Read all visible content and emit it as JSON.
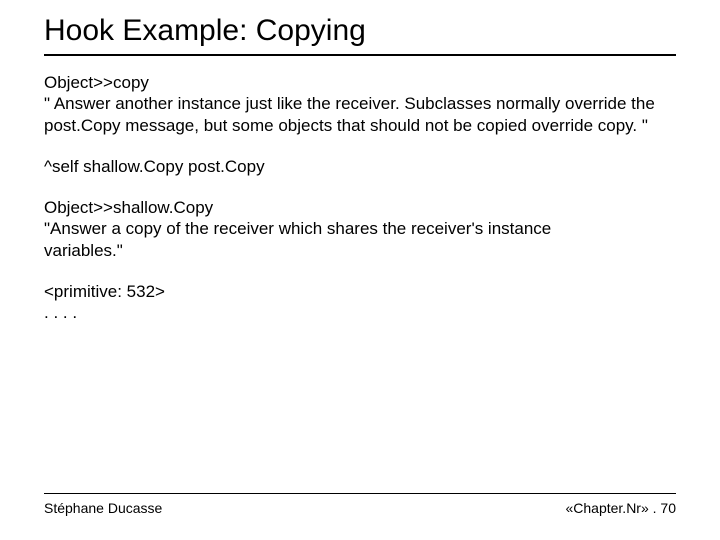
{
  "title": "Hook Example: Copying",
  "method1": {
    "sig": "Object>>copy",
    "comment": "\" Answer another instance just like the receiver. Subclasses normally override the post.Copy message, but some objects that should not be copied override copy. \"",
    "body": "^self shallow.Copy post.Copy"
  },
  "method2": {
    "sig": "Object>>shallow.Copy",
    "comment": "\"Answer a copy of the receiver which shares the receiver's instance",
    "comment2": "variables.\"",
    "prim": "<primitive: 532>",
    "dots": ". . . ."
  },
  "footer": {
    "author": "Stéphane Ducasse",
    "page": "«Chapter.Nr» . 70"
  }
}
